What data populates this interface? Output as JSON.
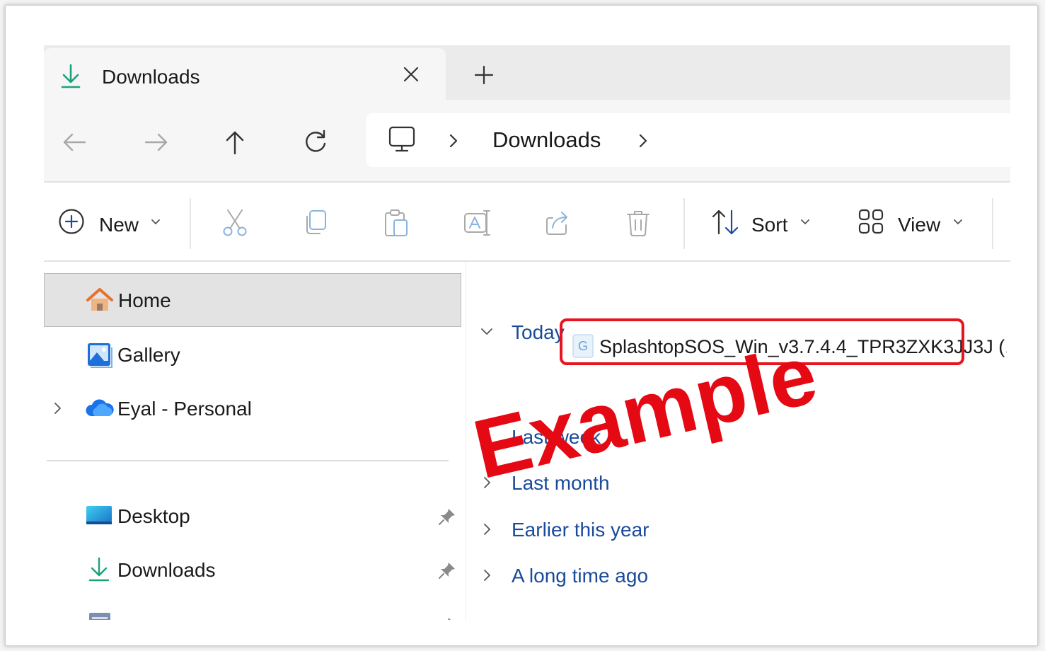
{
  "tab": {
    "title": "Downloads"
  },
  "address": {
    "path": [
      "Downloads"
    ]
  },
  "commands": {
    "new_label": "New",
    "sort_label": "Sort",
    "view_label": "View"
  },
  "sidebar": {
    "items": [
      {
        "label": "Home",
        "icon": "home-icon",
        "selected": true
      },
      {
        "label": "Gallery",
        "icon": "gallery-icon"
      },
      {
        "label": "Eyal - Personal",
        "icon": "onedrive-cloud-icon"
      }
    ],
    "pinned": [
      {
        "label": "Desktop",
        "icon": "desktop-folder-icon"
      },
      {
        "label": "Downloads",
        "icon": "download-icon"
      }
    ]
  },
  "content": {
    "groups": [
      {
        "label": "Today",
        "expanded": true
      },
      {
        "label": "Last week"
      },
      {
        "label": "Last month"
      },
      {
        "label": "Earlier this year"
      },
      {
        "label": "A long time ago"
      }
    ],
    "file": {
      "name": "SplashtopSOS_Win_v3.7.4.4_TPR3ZXK3JJ3J (..."
    }
  },
  "overlay": {
    "watermark": "Example"
  },
  "colors": {
    "accent": "#1a4a9a",
    "highlight": "#e8141e",
    "download_green": "#1aa37a"
  }
}
